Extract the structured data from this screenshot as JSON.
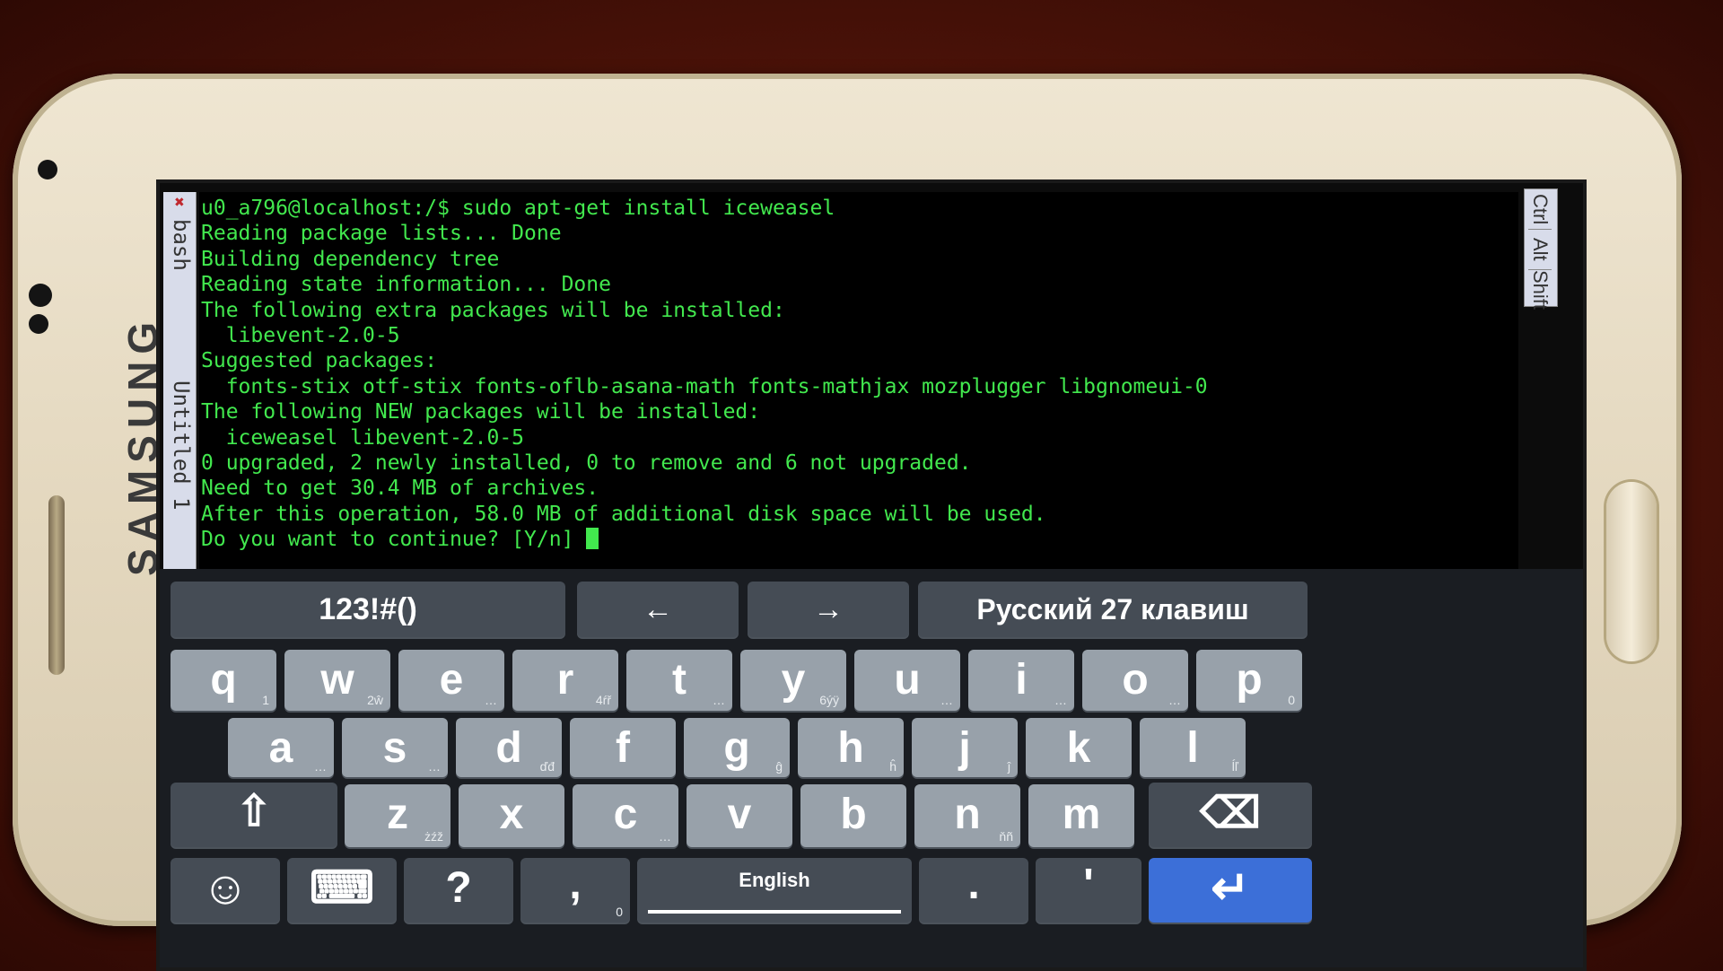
{
  "device": {
    "brand": "SAMSUNG"
  },
  "terminal": {
    "tabs": [
      "bash",
      "Untitled 1"
    ],
    "mod_keys": [
      "Ctrl",
      "Alt",
      "Shift"
    ],
    "lines": [
      "u0_a796@localhost:/$ sudo apt-get install iceweasel",
      "Reading package lists... Done",
      "Building dependency tree",
      "Reading state information... Done",
      "The following extra packages will be installed:",
      "  libevent-2.0-5",
      "Suggested packages:",
      "  fonts-stix otf-stix fonts-oflb-asana-math fonts-mathjax mozplugger libgnomeui-0",
      "The following NEW packages will be installed:",
      "  iceweasel libevent-2.0-5",
      "0 upgraded, 2 newly installed, 0 to remove and 6 not upgraded.",
      "Need to get 30.4 MB of archives.",
      "After this operation, 58.0 MB of additional disk space will be used.",
      "Do you want to continue? [Y/n] "
    ]
  },
  "keyboard": {
    "top_row": {
      "symbols": "123!#()",
      "left_arrow": "←",
      "right_arrow": "→",
      "language": "Русский 27 клавиш"
    },
    "row1": [
      {
        "k": "q",
        "s": "1"
      },
      {
        "k": "w",
        "s": "2ŵ"
      },
      {
        "k": "e",
        "s": "…"
      },
      {
        "k": "r",
        "s": "4ŕř"
      },
      {
        "k": "t",
        "s": "…"
      },
      {
        "k": "y",
        "s": "6ýÿ"
      },
      {
        "k": "u",
        "s": "…"
      },
      {
        "k": "i",
        "s": "…"
      },
      {
        "k": "o",
        "s": "…"
      },
      {
        "k": "p",
        "s": "0"
      }
    ],
    "row2": [
      {
        "k": "a",
        "s": "…"
      },
      {
        "k": "s",
        "s": "…"
      },
      {
        "k": "d",
        "s": "ďđ"
      },
      {
        "k": "f",
        "s": ""
      },
      {
        "k": "g",
        "s": "ĝ"
      },
      {
        "k": "h",
        "s": "ĥ"
      },
      {
        "k": "j",
        "s": "ĵ"
      },
      {
        "k": "k",
        "s": ""
      },
      {
        "k": "l",
        "s": "ĺľ"
      }
    ],
    "row3": [
      {
        "k": "z",
        "s": "żźž"
      },
      {
        "k": "x",
        "s": ""
      },
      {
        "k": "c",
        "s": "…"
      },
      {
        "k": "v",
        "s": ""
      },
      {
        "k": "b",
        "s": ""
      },
      {
        "k": "n",
        "s": "ňñ"
      },
      {
        "k": "m",
        "s": ""
      }
    ],
    "shift": "⇧",
    "backspace": "⌫",
    "bottom": {
      "emoji": "☺",
      "keyboard_toggle": "⌨",
      "question": "?",
      "comma": ",",
      "comma_sub": "0",
      "space_label": "English",
      "period": ".",
      "apostrophe": "'",
      "enter": "↵"
    }
  }
}
